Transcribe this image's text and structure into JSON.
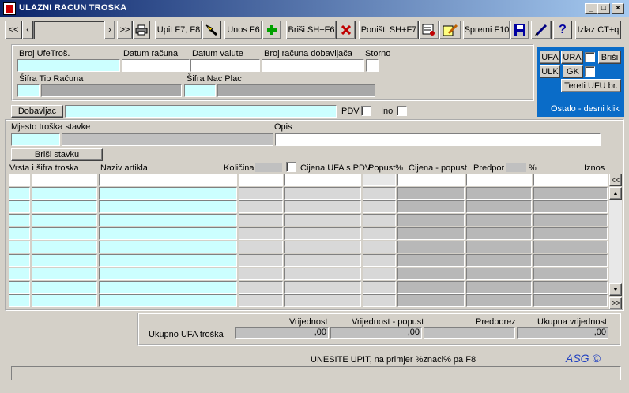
{
  "window": {
    "title": "ULAZNI RACUN TROSKA",
    "minimize": "_",
    "maximize": "□",
    "close": "×"
  },
  "toolbar": {
    "first": "<<",
    "prev": "‹",
    "next": "›",
    "last": ">>",
    "upit": "Upit F7, F8",
    "unos": "Unos F6",
    "brisi": "Briši  SH+F6",
    "ponisti": "Poništi SH+F7",
    "spremi": "Spremi F10",
    "help": "?",
    "izlaz": "Izlaz CT+q"
  },
  "header": {
    "broj_ufe": "Broj UfeTroš.",
    "datum_racuna": "Datum računa",
    "datum_valute": "Datum valute",
    "broj_racuna_dob": "Broj računa dobavljača",
    "storno": "Storno",
    "sifra_tip": "Šifra Tip Računa",
    "sifra_nac": "Šifra Nac Plac"
  },
  "sidepanel": {
    "ufa": "UFA",
    "ura": "URA",
    "brisi": "Briši",
    "ulk": "ULK",
    "gk": "GK",
    "tereti": "Tereti UFU br.",
    "ostalo": "Ostalo - desni  klik",
    "accent": "#0a6cc8"
  },
  "supplier": {
    "dobavljac": "Dobavljac",
    "pdv": "PDV",
    "ino": "Ino"
  },
  "detail": {
    "mjesto": "Mjesto troška stavke",
    "opis": "Opis",
    "brisi_stavku": "Briši stavku"
  },
  "grid": {
    "columns": [
      "Vrsta i šifra troska",
      "Naziv artikla",
      "Količina",
      "Cijena UFA s PDV",
      "Popust%",
      "Cijena - popust",
      "Predpor",
      "%",
      "Iznos"
    ],
    "row_count": 10,
    "scroll_top": "<<",
    "scroll_bottom": ">>"
  },
  "totals": {
    "label": "Ukupno UFA troška",
    "vrijednost": "Vrijednost",
    "vrijednost_popust": "Vrijednost - popust",
    "predporez": "Predporez",
    "ukupna": "Ukupna vrijednost",
    "v1": ",00",
    "v2": ",00",
    "v3": "",
    "v4": ",00"
  },
  "status": {
    "hint": "UNESITE UPIT, na primjer %znaci% pa F8",
    "logo": "ASG ©"
  }
}
